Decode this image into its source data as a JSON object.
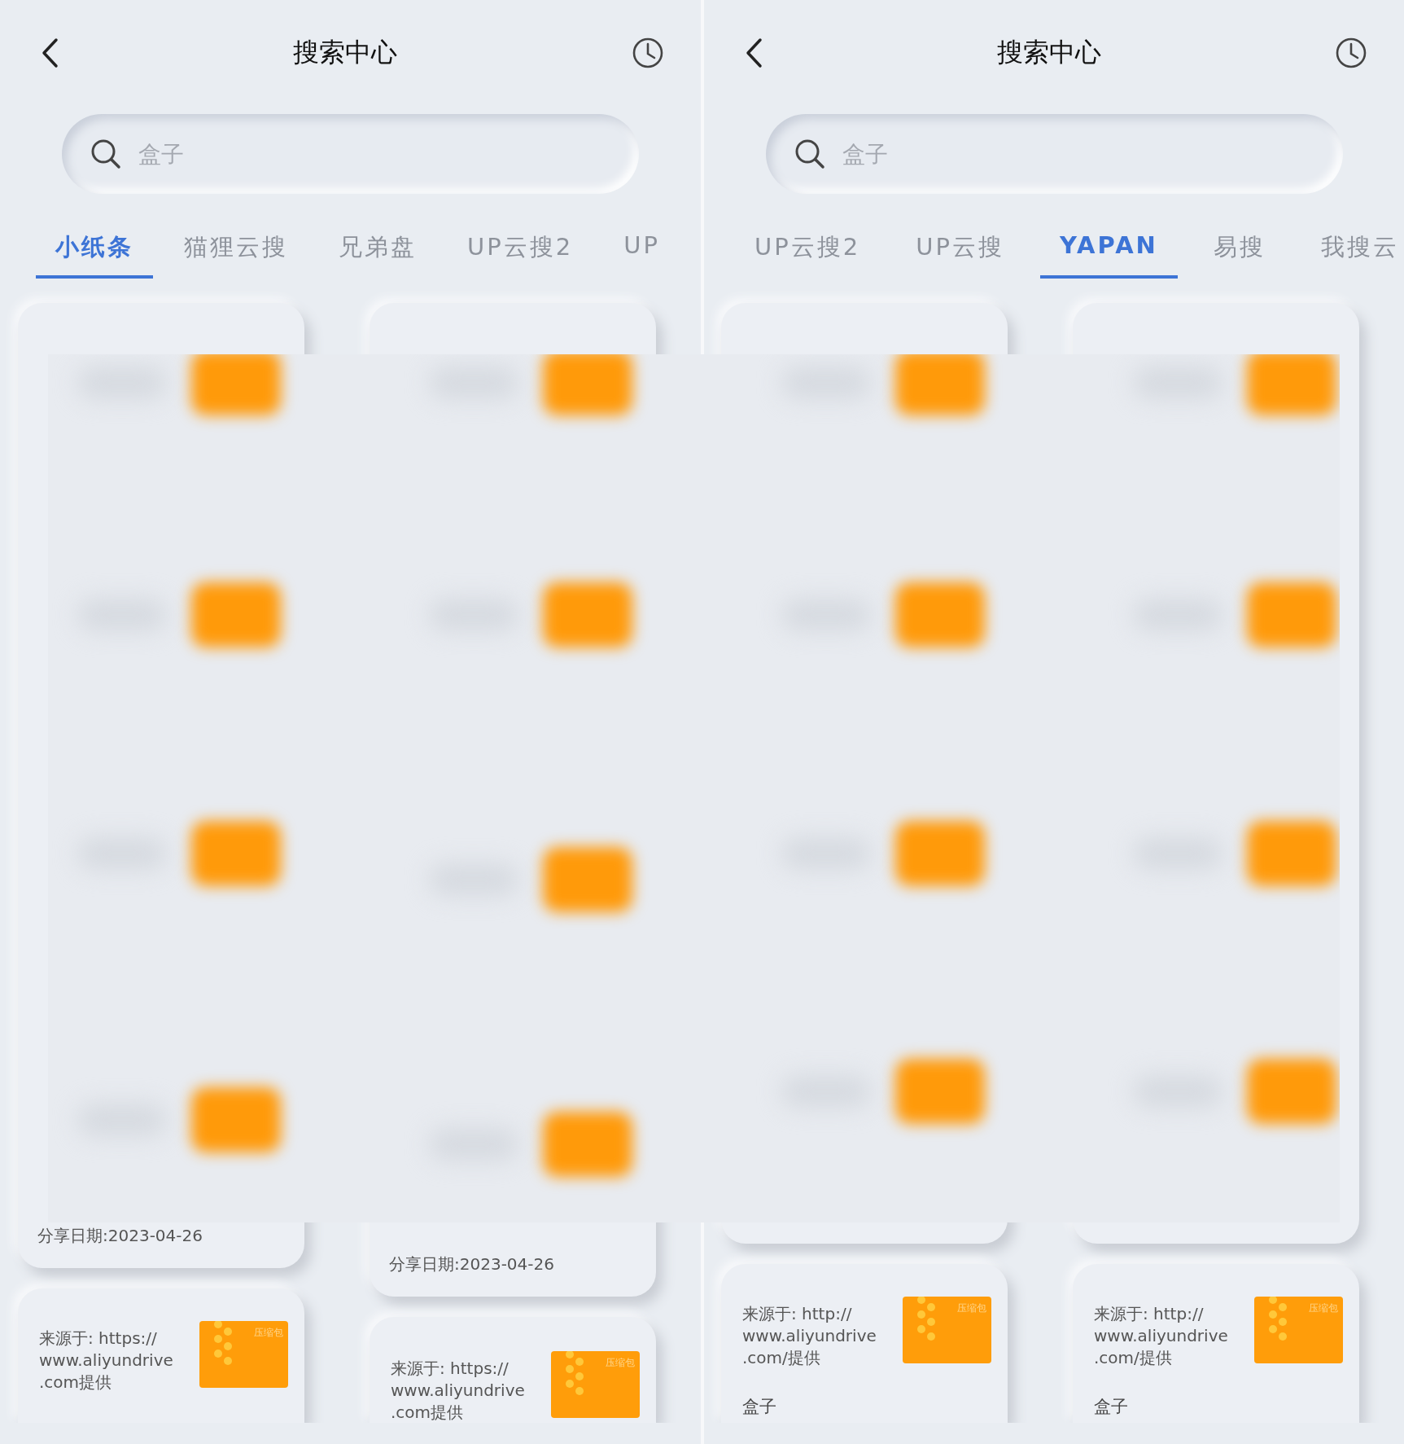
{
  "panes": [
    {
      "title": "搜索中心",
      "search": {
        "placeholder": "盒子"
      },
      "tabs": [
        {
          "label": "小纸条",
          "selected": true
        },
        {
          "label": "猫狸云搜",
          "selected": false
        },
        {
          "label": "兄弟盘",
          "selected": false
        },
        {
          "label": "UP云搜2",
          "selected": false
        },
        {
          "label": "UP",
          "selected": false
        }
      ],
      "columns": [
        {
          "date": "分享日期:2023-04-26",
          "card": {
            "source": "来源于: https://\nwww.aliyundrive\n.com提供",
            "file_label": "压缩包"
          }
        },
        {
          "date": "分享日期:2023-04-26",
          "card": {
            "source": "来源于: https://\nwww.aliyundrive\n.com提供",
            "file_label": "压缩包"
          }
        }
      ]
    },
    {
      "title": "搜索中心",
      "search": {
        "placeholder": "盒子"
      },
      "tabs": [
        {
          "label": "UP云搜2",
          "selected": false
        },
        {
          "label": "UP云搜",
          "selected": false
        },
        {
          "label": "YAPAN",
          "selected": true
        },
        {
          "label": "易搜",
          "selected": false
        },
        {
          "label": "我搜云",
          "selected": false
        }
      ],
      "columns": [
        {
          "card": {
            "source": "来源于: http://\nwww.aliyundrive\n.com/提供",
            "file_label": "压缩包",
            "title": "盒子"
          }
        },
        {
          "card": {
            "source": "来源于: http://\nwww.aliyundrive\n.com/提供",
            "file_label": "压缩包",
            "title": "盒子"
          }
        }
      ]
    }
  ]
}
